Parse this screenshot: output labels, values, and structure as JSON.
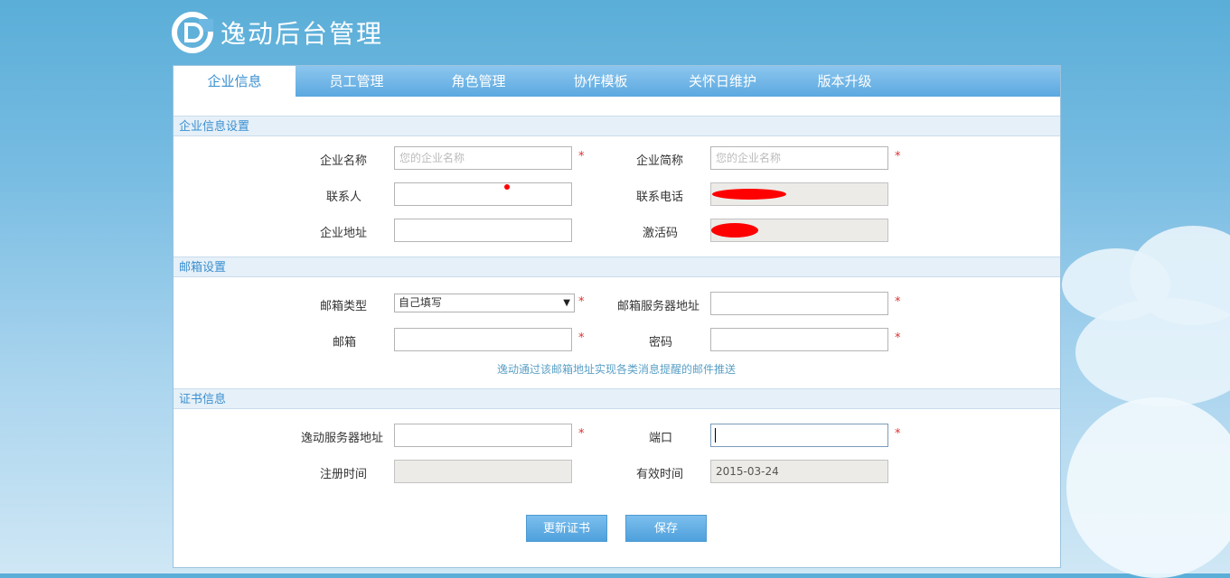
{
  "app": {
    "title": "逸动后台管理"
  },
  "tabs": [
    {
      "label": "企业信息",
      "active": true
    },
    {
      "label": "员工管理",
      "active": false
    },
    {
      "label": "角色管理",
      "active": false
    },
    {
      "label": "协作模板",
      "active": false
    },
    {
      "label": "关怀日维护",
      "active": false
    },
    {
      "label": "版本升级",
      "active": false
    }
  ],
  "company": {
    "section_title": "企业信息设置",
    "name_label": "企业名称",
    "name_placeholder": "您的企业名称",
    "short_label": "企业简称",
    "short_placeholder": "您的企业名称",
    "contact_label": "联系人",
    "contact_value": "",
    "phone_label": "联系电话",
    "address_label": "企业地址",
    "address_value": "",
    "activation_label": "激活码"
  },
  "mail": {
    "section_title": "邮箱设置",
    "type_label": "邮箱类型",
    "type_selected": "自己填写",
    "server_label": "邮箱服务器地址",
    "server_value": "",
    "email_label": "邮箱",
    "email_value": "",
    "password_label": "密码",
    "password_value": "",
    "hint": "逸动通过该邮箱地址实现各类消息提醒的邮件推送"
  },
  "cert": {
    "section_title": "证书信息",
    "server_label": "逸动服务器地址",
    "server_value": "",
    "port_label": "端口",
    "port_value": "",
    "register_label": "注册时间",
    "register_value": "",
    "valid_label": "有效时间",
    "valid_value": "2015-03-24"
  },
  "required_mark": "*",
  "actions": {
    "update_cert": "更新证书",
    "save": "保存"
  },
  "colors": {
    "accent": "#3a8fd0",
    "tab_bg": "#5ba8e0",
    "required": "#e03030",
    "button": "#4ea0dc"
  }
}
